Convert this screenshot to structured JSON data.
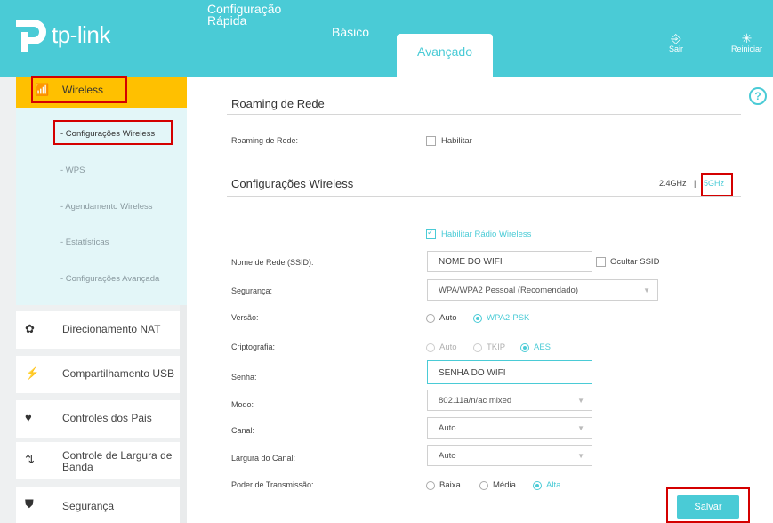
{
  "brand": {
    "name": "tp-link"
  },
  "tabs": {
    "quick_setup": "Configuração Rápida",
    "basic": "Básico",
    "advanced": "Avançado"
  },
  "top_actions": {
    "logout": "Sair",
    "reboot": "Reiniciar"
  },
  "sidebar": {
    "wireless": {
      "label": "Wireless",
      "subitems": [
        "- Configurações Wireless",
        "- WPS",
        "- Agendamento Wireless",
        "- Estatísticas",
        "- Configurações Avançada"
      ]
    },
    "items": [
      {
        "label": "Direcionamento NAT",
        "icon": "nat-icon"
      },
      {
        "label": "Compartilhamento USB",
        "icon": "usb-icon"
      },
      {
        "label": "Controles dos Pais",
        "icon": "parental-heart-icon"
      },
      {
        "label": "Controle de Largura de Banda",
        "icon": "bandwidth-arrows-icon"
      },
      {
        "label": "Segurança",
        "icon": "shield-icon"
      }
    ]
  },
  "roaming": {
    "title": "Roaming de Rede",
    "field_label": "Roaming de Rede:",
    "enable_label": "Habilitar",
    "enabled": false
  },
  "wireless_settings": {
    "title": "Configurações Wireless",
    "band_24": "2.4GHz",
    "band_sep": "|",
    "band_5": "5GHz",
    "enable_radio_label": "Habilitar Rádio Wireless",
    "ssid_label": "Nome de Rede (SSID):",
    "ssid_value": "NOME DO WIFI",
    "hide_ssid_label": "Ocultar SSID",
    "security_label": "Segurança:",
    "security_value": "WPA/WPA2 Pessoal (Recomendado)",
    "version_label": "Versão:",
    "version_options": [
      "Auto",
      "WPA2-PSK"
    ],
    "version_selected": "WPA2-PSK",
    "encryption_label": "Criptografia:",
    "encryption_options": [
      "Auto",
      "TKIP",
      "AES"
    ],
    "encryption_selected": "AES",
    "password_label": "Senha:",
    "password_value": "SENHA DO WIFI",
    "mode_label": "Modo:",
    "mode_value": "802.11a/n/ac mixed",
    "channel_label": "Canal:",
    "channel_value": "Auto",
    "width_label": "Largura do Canal:",
    "width_value": "Auto",
    "power_label": "Poder de Transmissão:",
    "power_options": [
      "Baixa",
      "Média",
      "Alta"
    ],
    "power_selected": "Alta"
  },
  "buttons": {
    "save": "Salvar",
    "help": "?"
  },
  "colors": {
    "accent": "#4acbd6",
    "highlight": "#ffc000",
    "annotation": "#d40000"
  }
}
